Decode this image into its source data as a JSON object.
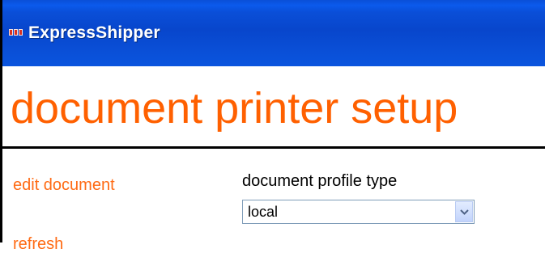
{
  "window": {
    "title": "ExpressShipper"
  },
  "page": {
    "heading": "document printer setup"
  },
  "sidebar": {
    "items": [
      {
        "label": "edit document"
      },
      {
        "label": "refresh"
      }
    ]
  },
  "form": {
    "profile_type": {
      "label": "document profile type",
      "value": "local",
      "icon": "chevron-down-icon"
    }
  },
  "colors": {
    "titlebar": "#0a4fd8",
    "accent": "#ff6000"
  }
}
